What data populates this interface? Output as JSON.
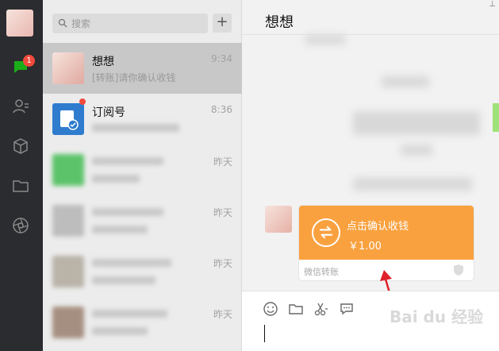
{
  "sidebar": {
    "badge_count": "1"
  },
  "search": {
    "placeholder": "搜索",
    "add_label": "+"
  },
  "chats": [
    {
      "name": "想想",
      "message": "[转账]请你确认收钱",
      "time": "9:34"
    },
    {
      "name": "订阅号",
      "message": "",
      "time": "8:36"
    },
    {
      "name": "",
      "message": "",
      "time": "昨天"
    },
    {
      "name": "",
      "message": "",
      "time": "昨天"
    },
    {
      "name": "",
      "message": "",
      "time": "昨天"
    },
    {
      "name": "",
      "message": "",
      "time": "昨天"
    }
  ],
  "conversation": {
    "title": "想想",
    "pin_icon": "pin-icon",
    "transfer": {
      "label": "点击确认收钱",
      "amount": "￥1.00",
      "footer": "微信转账",
      "color": "#f9a13f"
    }
  },
  "toolbar": {
    "icons": [
      "emoji-icon",
      "folder-icon",
      "scissors-icon",
      "chat-bubble-icon"
    ]
  },
  "watermark": {
    "text": "Bai du 经验"
  }
}
